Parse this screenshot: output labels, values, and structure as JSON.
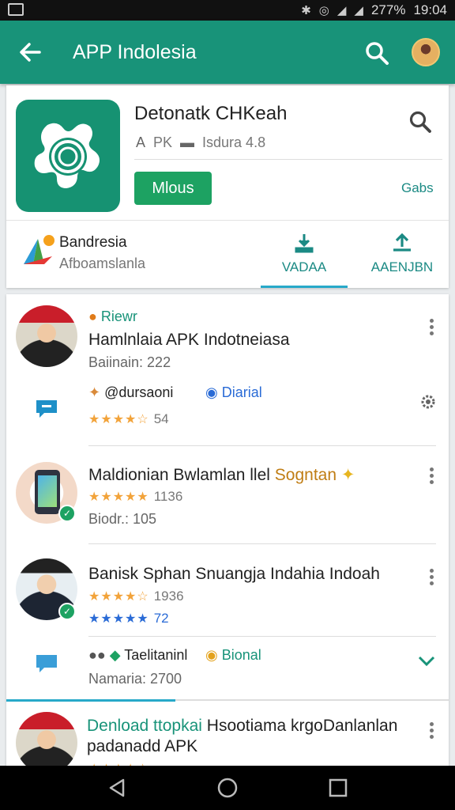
{
  "status_bar": {
    "battery": "277%",
    "time": "19:04"
  },
  "app_bar": {
    "title": "APP Indolesia"
  },
  "app_card": {
    "name": "Detonatk CHKeah",
    "meta_type": "PK",
    "meta_lang": "Isdura 4.8",
    "primary_button": "Mlous",
    "right_link": "Gabs",
    "developer": {
      "name": "Bandresia",
      "subtitle": "Afboamslanla"
    },
    "tabs": [
      {
        "label": "VADAA"
      },
      {
        "label": "AAENJBN"
      }
    ]
  },
  "list": {
    "items": [
      {
        "tag": "Riewr",
        "title": "Hamlnlaia APK Indotneiasa",
        "sub": "Baiinain: 222",
        "row2_handle": "@dursaoni",
        "row2_tag": "Diarial",
        "rating_count": "54"
      },
      {
        "title_a": "Maldionian Bwlamlan llel",
        "title_b": "Sogntan",
        "rating_count": "1136",
        "sub": "Biodr.: 105"
      },
      {
        "title": "Banisk Sphan Snuangja Indahia Indoah",
        "rating_count": "1936",
        "rating_blue": "72",
        "row2_name": "Taelitaninl",
        "row2_tag": "Bional",
        "sub2": "Namaria: 2700"
      },
      {
        "title_a": "Denload ttopkai",
        "title_b": "Hsootiama krgoDanlanlan",
        "title_line2": "padanadd APK"
      }
    ]
  },
  "colors": {
    "primary": "#189379",
    "accent": "#1da262",
    "link": "#1b8a84",
    "star": "#f2a33a"
  }
}
